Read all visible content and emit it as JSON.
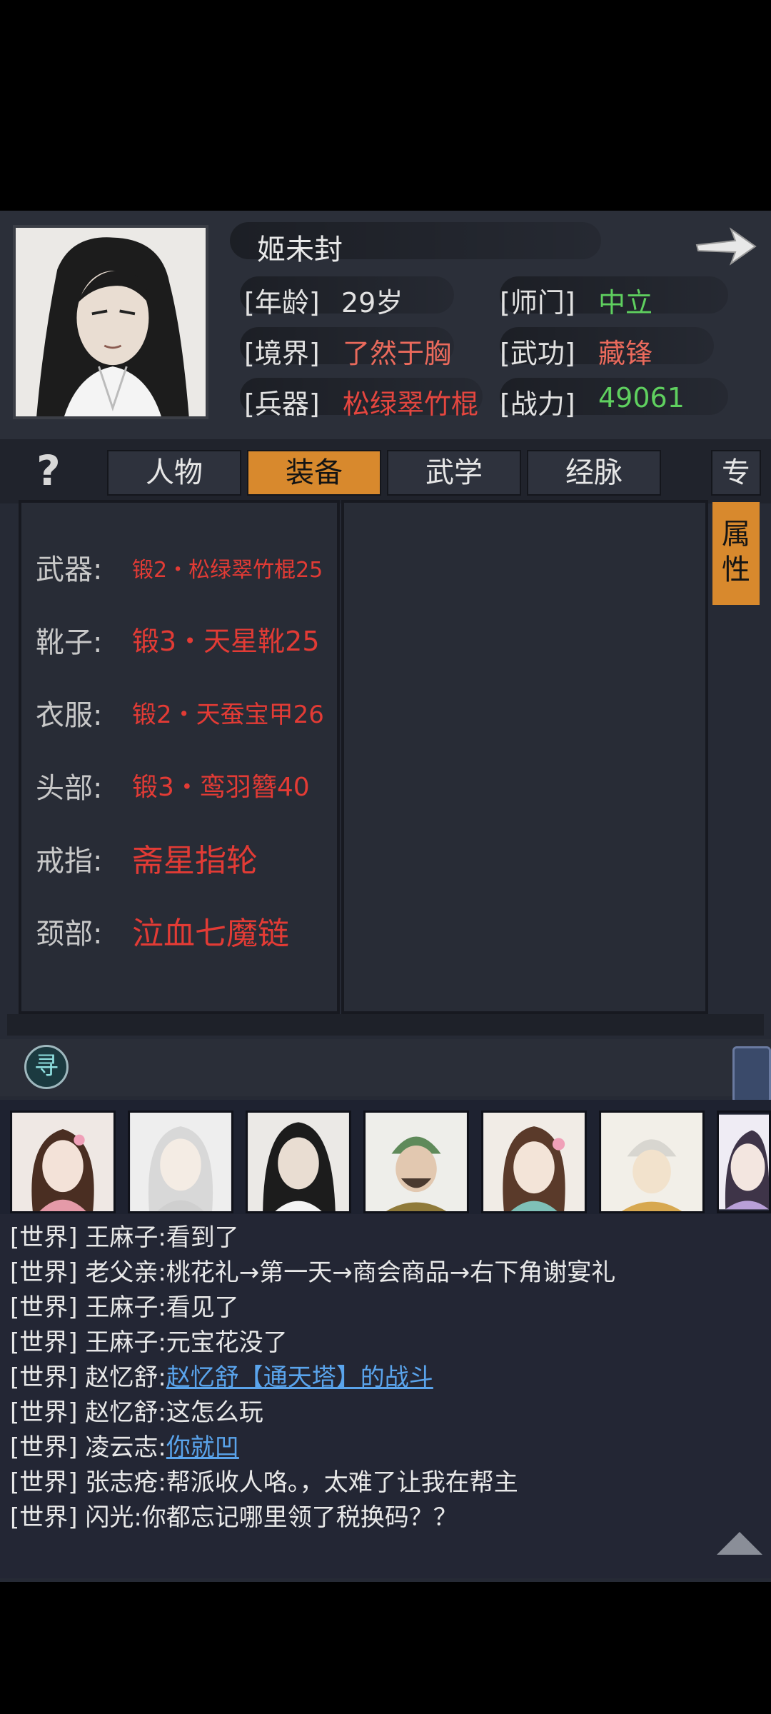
{
  "character": {
    "name": "姬未封",
    "stats": [
      {
        "label": "[年龄]",
        "value": "29岁"
      },
      {
        "label": "[师门]",
        "value": "中立"
      },
      {
        "label": "[境界]",
        "value": "了然于胸"
      },
      {
        "label": "[武功]",
        "value": "藏锋"
      },
      {
        "label": "[兵器]",
        "value": "松绿翠竹棍"
      },
      {
        "label": "[战力]",
        "value": "49061"
      }
    ]
  },
  "tabs": {
    "help": "?",
    "items": [
      "人物",
      "装备",
      "武学",
      "经脉"
    ],
    "active": "装备",
    "side_top": "专",
    "side_attr": [
      "属",
      "性"
    ]
  },
  "equipment": [
    {
      "label": "武器:",
      "value": "锻2・松绿翠竹棍25"
    },
    {
      "label": "靴子:",
      "value": "锻3・天星靴25"
    },
    {
      "label": "衣服:",
      "value": "锻2・天蚕宝甲26"
    },
    {
      "label": "头部:",
      "value": "锻3・鸾羽簪40"
    },
    {
      "label": "戒指:",
      "value": "斋星指轮"
    },
    {
      "label": "颈部:",
      "value": "泣血七魔链"
    }
  ],
  "seal_glyph": "寻",
  "chat": [
    {
      "channel": "[世界]",
      "user": "王麻子",
      "text": ":看到了",
      "link": ""
    },
    {
      "channel": "[世界]",
      "user": "老父亲",
      "text": ":桃花礼→第一天→商会商品→右下角谢宴礼",
      "link": ""
    },
    {
      "channel": "[世界]",
      "user": "王麻子",
      "text": ":看见了",
      "link": ""
    },
    {
      "channel": "[世界]",
      "user": "王麻子",
      "text": ":元宝花没了",
      "link": ""
    },
    {
      "channel": "[世界]",
      "user": "赵忆舒",
      "text": ":",
      "link": "赵忆舒【通天塔】的战斗"
    },
    {
      "channel": "[世界]",
      "user": "赵忆舒",
      "text": ":这怎么玩",
      "link": ""
    },
    {
      "channel": "[世界]",
      "user": "凌云志",
      "text": ":",
      "link": "你就凹"
    },
    {
      "channel": "[世界]",
      "user": "张志疮",
      "text": ":帮派收人咯。，太难了让我在帮主",
      "link": ""
    },
    {
      "channel": "[世界]",
      "user": "闪光",
      "text": ":你都忘记哪里领了税换码？？",
      "link": ""
    }
  ],
  "colors": {
    "accent": "#d8892d",
    "equip_red": "#e23b35",
    "stat_green": "#5fd05f",
    "link_blue": "#5aa4ec"
  }
}
